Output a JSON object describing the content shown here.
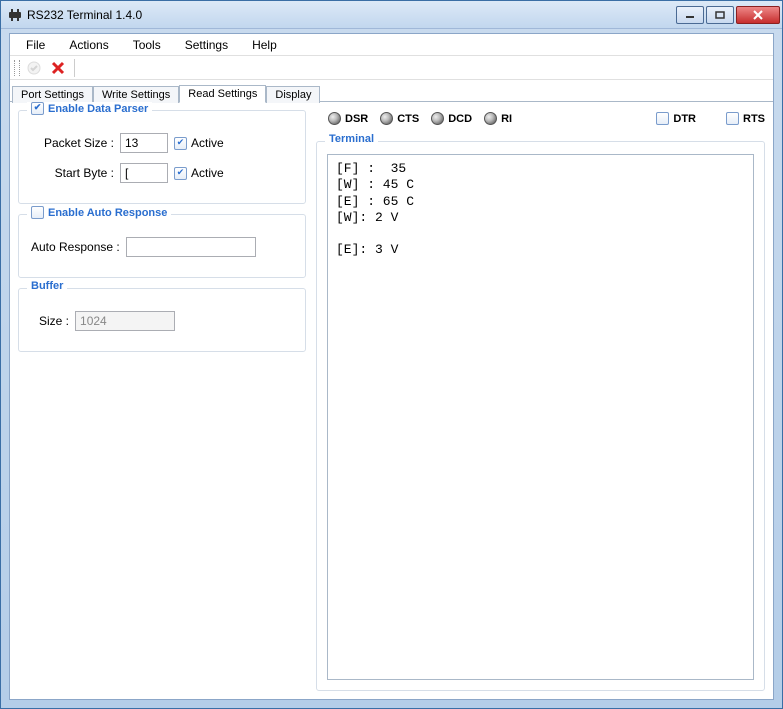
{
  "window": {
    "title": "RS232 Terminal 1.4.0"
  },
  "menu": {
    "file": "File",
    "actions": "Actions",
    "tools": "Tools",
    "settings": "Settings",
    "help": "Help"
  },
  "tabs": {
    "port": "Port Settings",
    "write": "Write Settings",
    "read": "Read Settings",
    "display": "Display"
  },
  "parser": {
    "title": "Enable Data Parser",
    "enabled": true,
    "packet_label": "Packet Size :",
    "packet_value": "13",
    "packet_active_label": "Active",
    "packet_active": true,
    "startbyte_label": "Start Byte :",
    "startbyte_value": "[",
    "startbyte_active_label": "Active",
    "startbyte_active": true
  },
  "autoresp": {
    "title": "Enable Auto Response",
    "enabled": false,
    "label": "Auto Response :",
    "value": ""
  },
  "buffer": {
    "title": "Buffer",
    "size_label": "Size :",
    "size_value": "1024"
  },
  "status": {
    "dsr": "DSR",
    "cts": "CTS",
    "dcd": "DCD",
    "ri": "RI",
    "dtr": "DTR",
    "rts": "RTS"
  },
  "terminal": {
    "title": "Terminal",
    "content": "[F] :  35\n[W] : 45 C\n[E] : 65 C\n[W]: 2 V\n\n[E]: 3 V"
  }
}
